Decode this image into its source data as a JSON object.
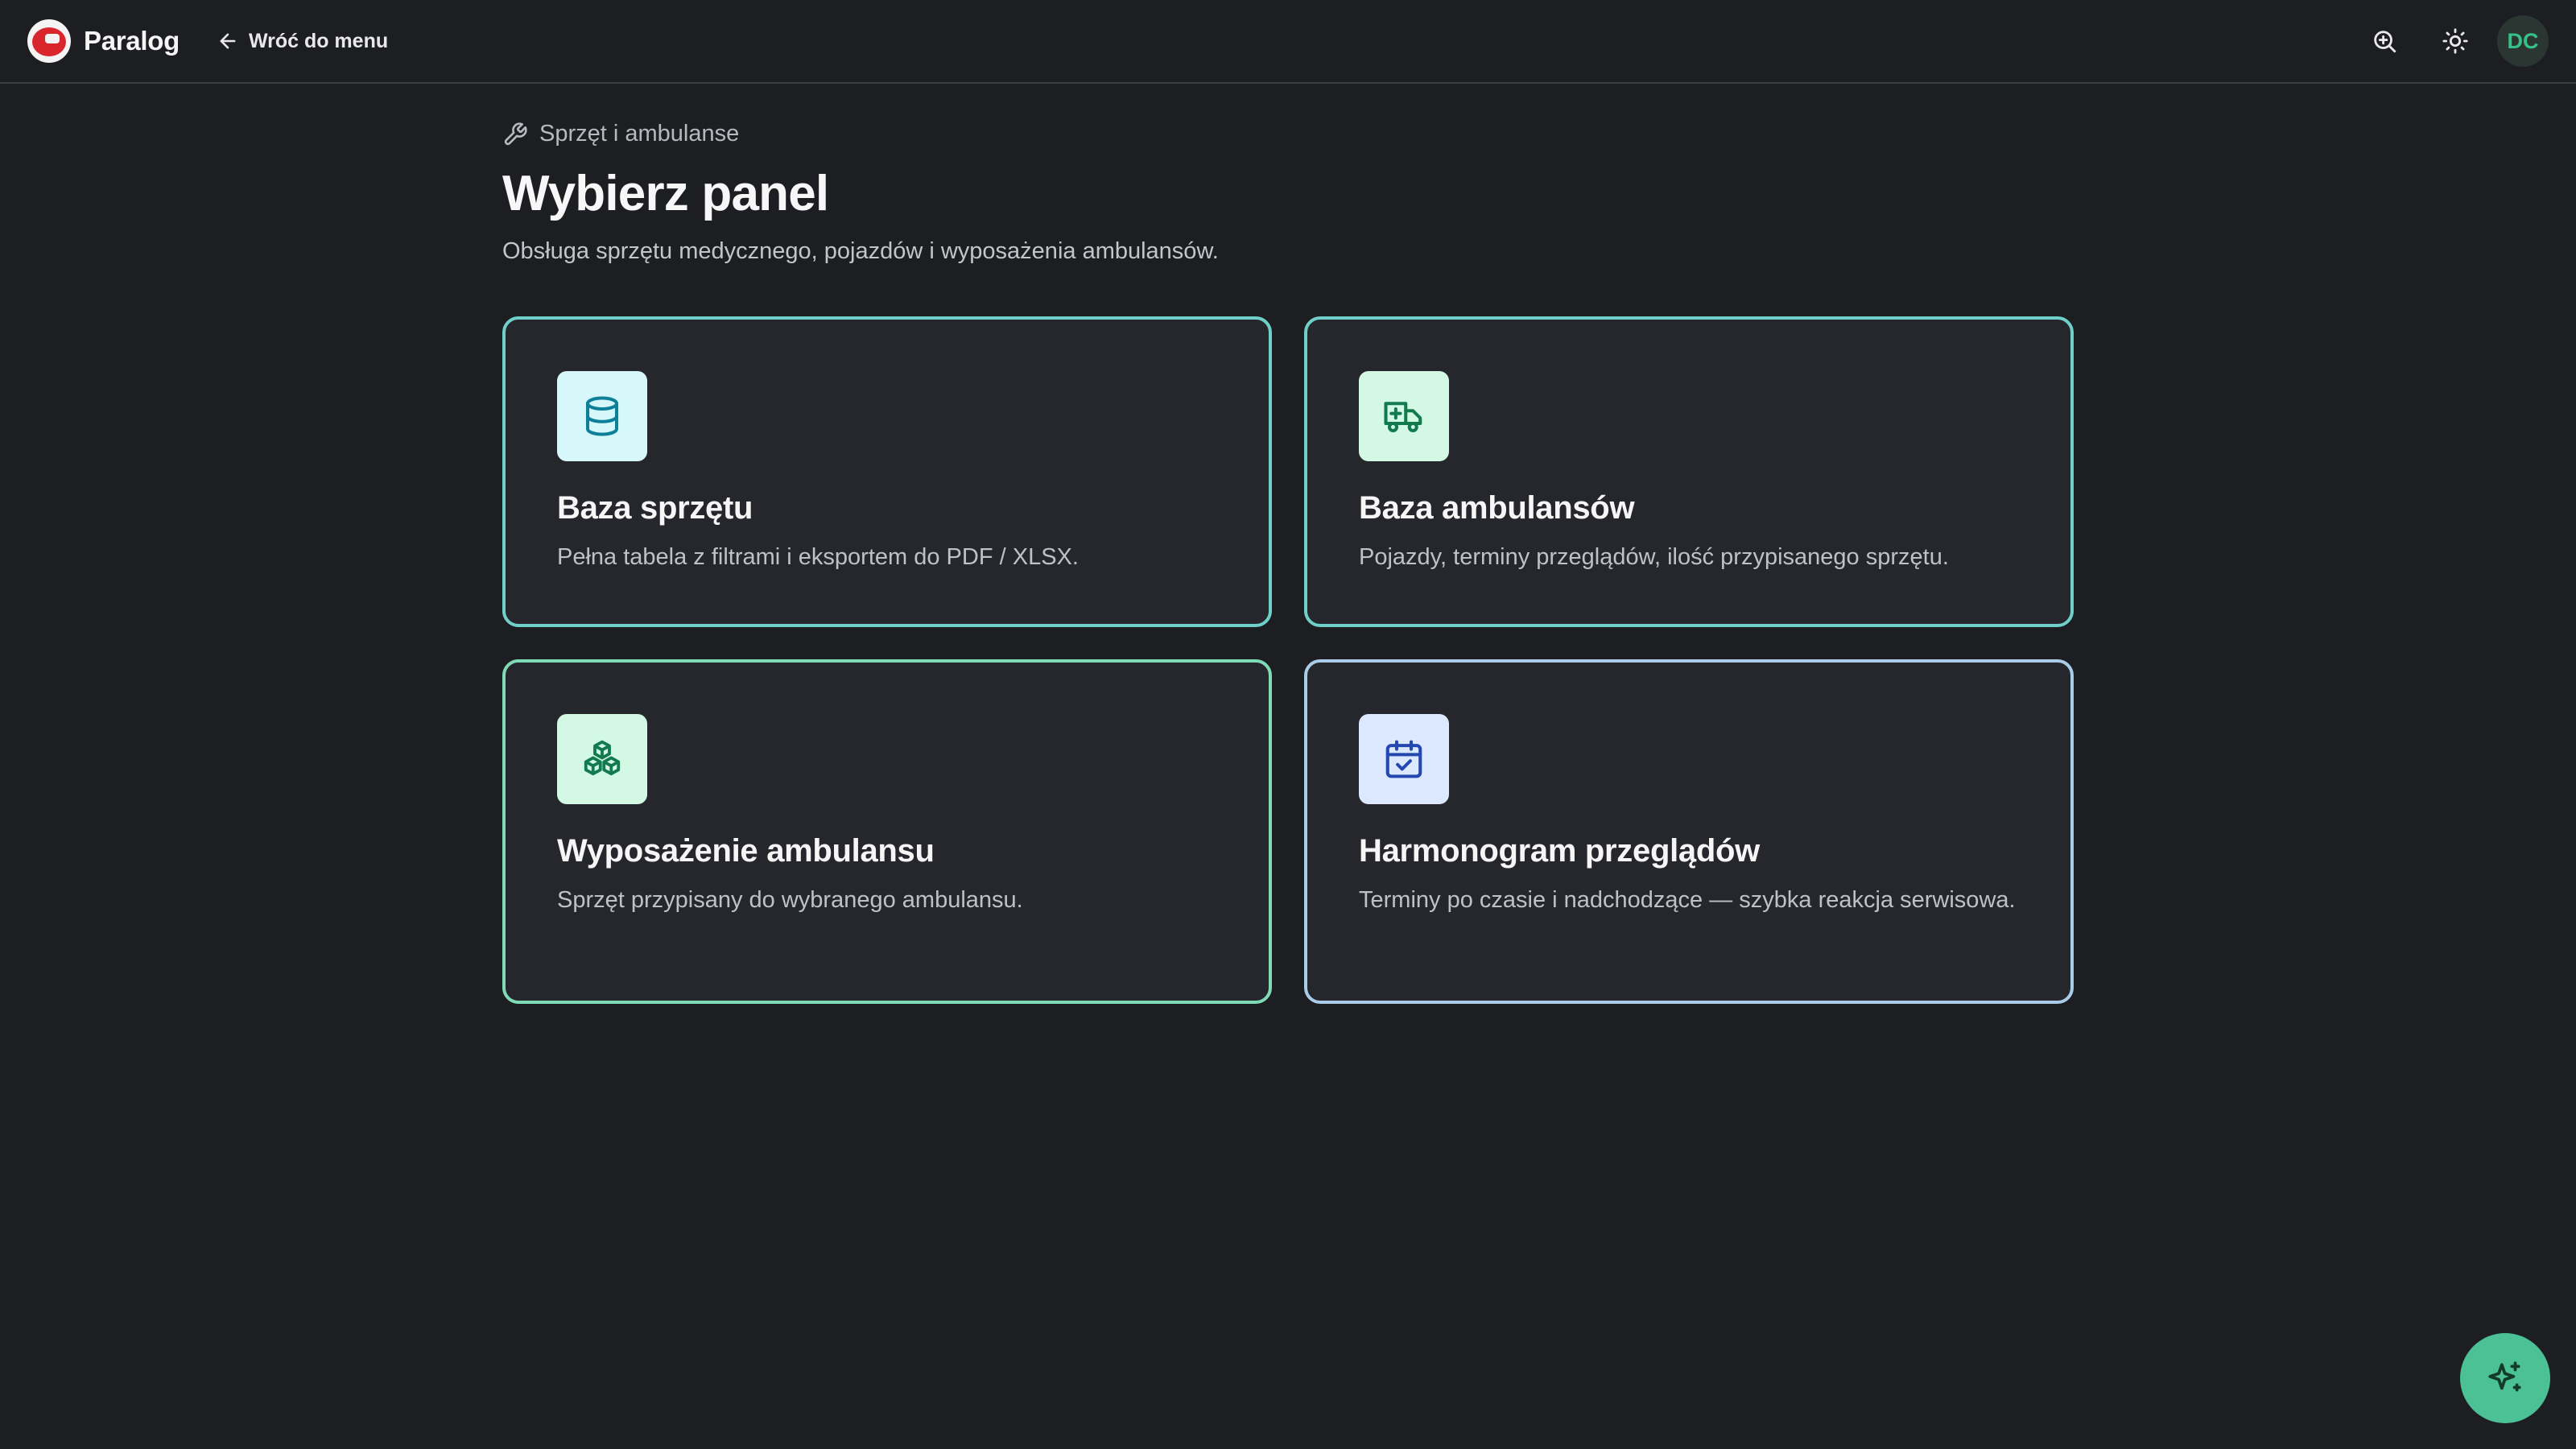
{
  "header": {
    "brand": "Paralog",
    "back_label": "Wróć do menu",
    "avatar_initials": "DC",
    "icons": [
      "zoom-in-icon",
      "sun-icon"
    ]
  },
  "main": {
    "breadcrumb": "Sprzęt i ambulanse",
    "title": "Wybierz panel",
    "subtitle": "Obsługa sprzętu medycznego, pojazdów i wyposażenia ambulansów.",
    "cards": [
      {
        "title": "Baza sprzętu",
        "description": "Pełna tabela z filtrami i eksportem do PDF / XLSX.",
        "icon": "database-icon"
      },
      {
        "title": "Baza ambulansów",
        "description": "Pojazdy, terminy przeglądów, ilość przypisanego sprzętu.",
        "icon": "ambulance-icon"
      },
      {
        "title": "Wyposażenie ambulansu",
        "description": "Sprzęt przypisany do wybranego ambulansu.",
        "icon": "boxes-icon"
      },
      {
        "title": "Harmonogram przeglądów",
        "description": "Terminy po czasie i nadchodzące — szybka reakcja serwisowa.",
        "icon": "calendar-check-icon"
      }
    ]
  },
  "colors": {
    "background": "#1d1e22",
    "card": "#26272d",
    "accent_teal": "#6fd0c9",
    "accent_green": "#4cc195",
    "avatar_text": "#34c28a"
  },
  "fab": {
    "icon": "sparkles-icon"
  }
}
